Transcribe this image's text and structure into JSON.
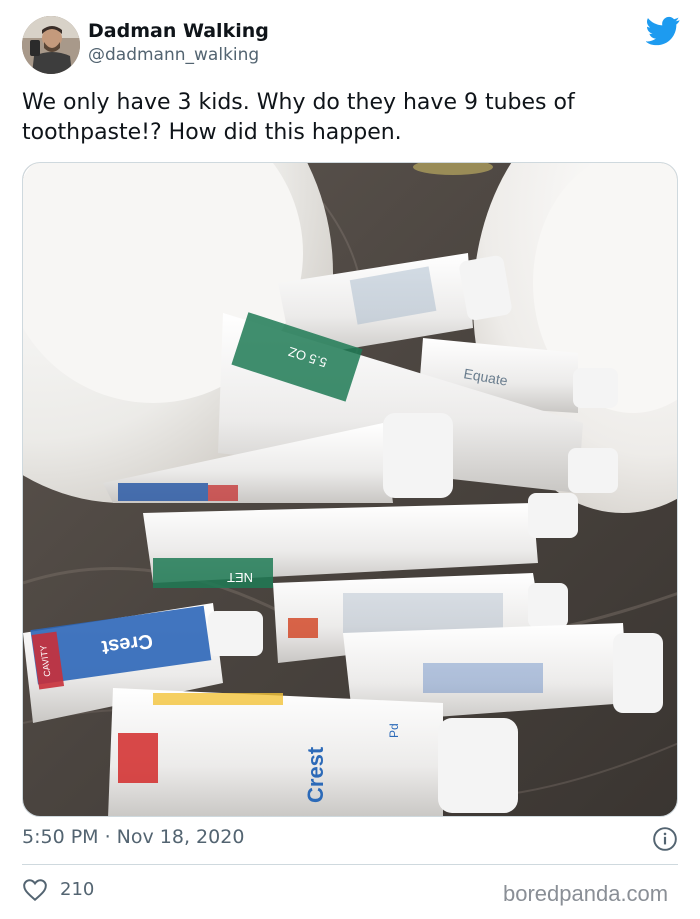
{
  "author": {
    "display_name": "Dadman Walking",
    "handle": "@dadmann_walking"
  },
  "tweet": {
    "text": "We only have 3 kids. Why do they have 9 tubes of toothpaste!? How did this happen.",
    "timestamp": "5:50 PM · Nov 18, 2020",
    "likes": "210"
  },
  "photo": {
    "tube_labels": [
      "NET",
      "5.5 OZ",
      "Crest",
      "CAVITY",
      "Equate",
      "Crest",
      "Pd"
    ]
  },
  "brand": {
    "watermark": "boredpanda.com",
    "twitter_color": "#1d9bf0"
  },
  "icons": {
    "platform": "twitter-bird-icon",
    "info": "info-icon",
    "like": "heart-icon"
  }
}
